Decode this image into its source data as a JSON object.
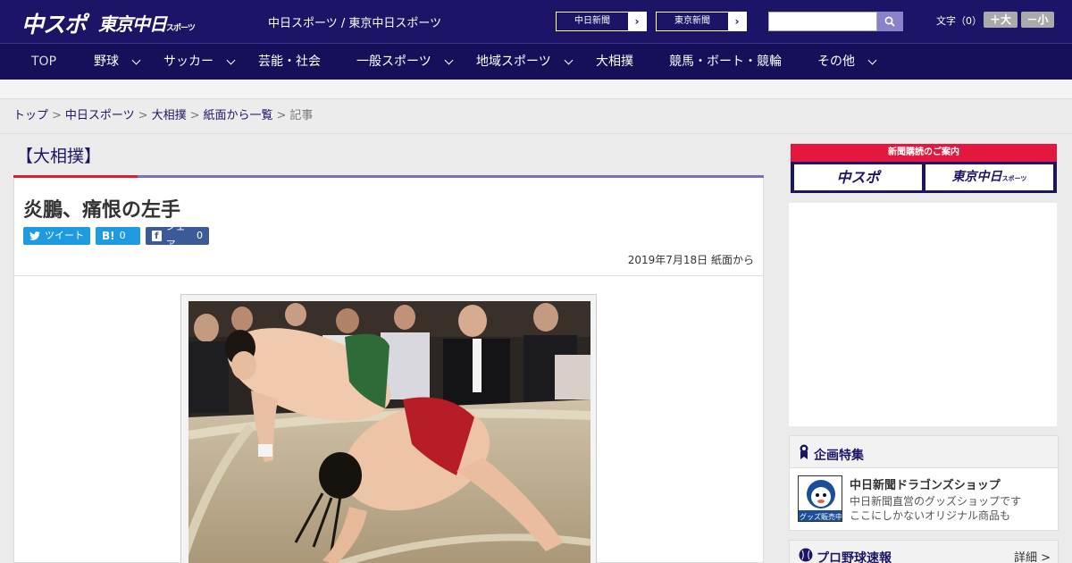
{
  "header": {
    "logo_chunichi_sports": "中スポ",
    "logo_tokyo_chunichi": "東京中日",
    "logo_tokyo_chunichi_sub": "スポーツ",
    "site_link": "中日スポーツ / 東京中日スポーツ",
    "paper_buttons": [
      "中日新聞",
      "東京新聞"
    ],
    "search_placeholder": "",
    "font_size_label": "文字（0）",
    "font_bigger": "＋大",
    "font_smaller": "－小",
    "brand_color": "#1c1466"
  },
  "nav": {
    "items": [
      "TOP",
      "野球",
      "サッカー",
      "芸能・社会",
      "一般スポーツ",
      "地域スポーツ",
      "大相撲",
      "競馬・ボート・競輪",
      "その他"
    ]
  },
  "breadcrumb": {
    "items": [
      "トップ",
      "中日スポーツ",
      "大相撲",
      "紙面から一覧"
    ],
    "current": "記事"
  },
  "section": {
    "title": "【大相撲】"
  },
  "article": {
    "headline": "炎鵬、痛恨の左手",
    "share": {
      "tweet": "ツイート",
      "hatena_count": "0",
      "facebook": "シェア",
      "facebook_count": "0"
    },
    "date": "2019年7月18日 紙面から"
  },
  "sidebar": {
    "subscription_banner": {
      "title": "新聞購読のご案内",
      "chunichi_sports": "中スポ",
      "tokyo_chunichi": "東京中日",
      "tokyo_chunichi_sub": "スポーツ"
    },
    "feature": {
      "title": "企画特集",
      "shop_name": "中日新聞ドラゴンズショップ",
      "shop_desc_1": "中日新聞直営のグッズショップです",
      "shop_desc_2": "ここにしかないオリジナル商品も",
      "thumb_caption": "グッズ販売中"
    },
    "baseball": {
      "title": "プロ野球速報",
      "detail": "詳細 >"
    }
  },
  "colors": {
    "accent_red": "#d81d37",
    "twitter": "#1e9ae0",
    "facebook": "#3d5a98"
  }
}
